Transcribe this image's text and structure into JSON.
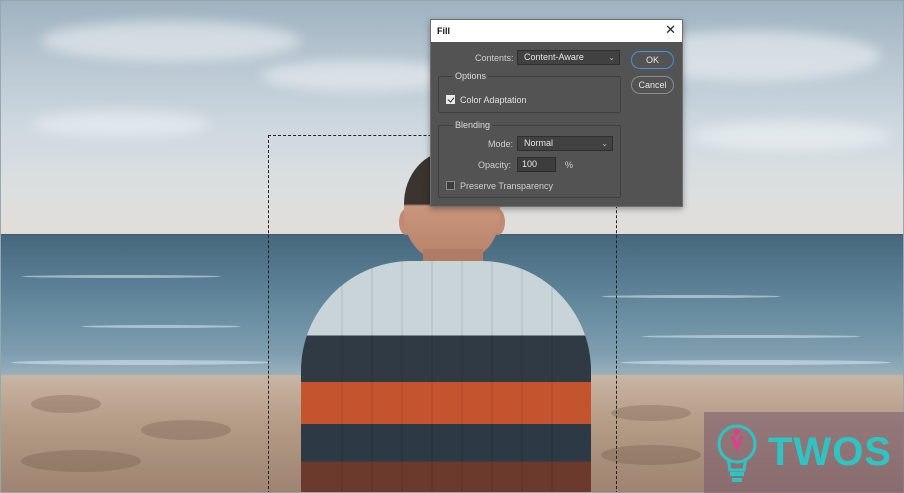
{
  "dialog": {
    "title": "Fill",
    "close_icon": "close-icon",
    "contents_label": "Contents:",
    "contents_value": "Content-Aware",
    "options_title": "Options",
    "color_adaptation_label": "Color Adaptation",
    "color_adaptation_checked": true,
    "blending_title": "Blending",
    "mode_label": "Mode:",
    "mode_value": "Normal",
    "opacity_label": "Opacity:",
    "opacity_value": "100",
    "opacity_unit": "%",
    "preserve_transparency_label": "Preserve Transparency",
    "preserve_transparency_checked": false,
    "ok_label": "OK",
    "cancel_label": "Cancel",
    "accent_color": "#4a8fdb"
  },
  "watermark": {
    "text": "TWOS",
    "icon": "lightbulb-logo-icon",
    "color": "#2ec4c4"
  }
}
